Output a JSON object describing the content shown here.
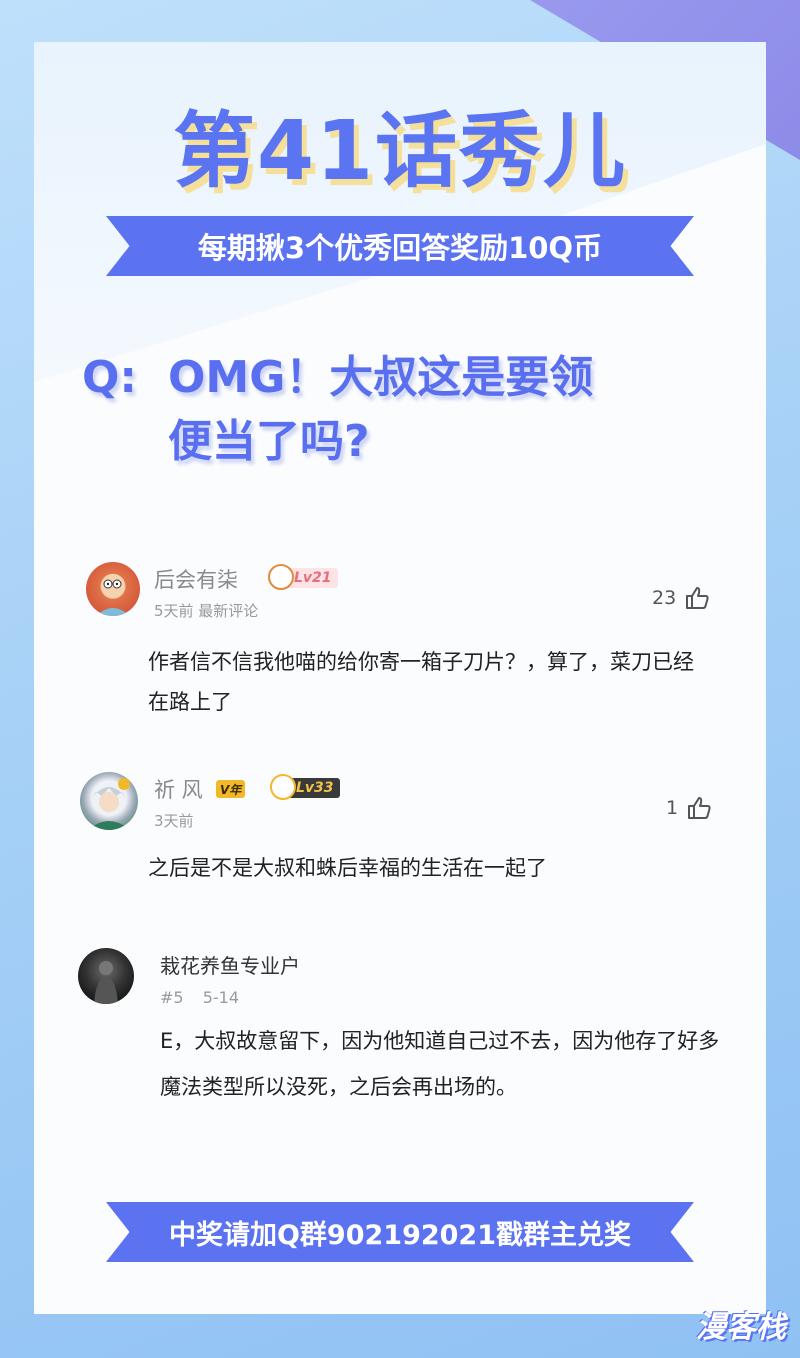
{
  "header": {
    "title": "第41话秀儿",
    "reward_banner": "每期揪3个优秀回答奖励10Q币"
  },
  "question": {
    "prefix": "Q:",
    "line1": "OMG！大叔这是要领",
    "line2": "便当了吗?"
  },
  "comments": [
    {
      "username": "后会有柒",
      "level": "Lv21",
      "meta": "5天前 最新评论",
      "likes": "23",
      "text": "作者信不信我他喵的给你寄一箱子刀片？，算了，菜刀已经在路上了"
    },
    {
      "username": "祈 风",
      "vip": "V年",
      "level": "Lv33",
      "meta": "3天前",
      "likes": "1",
      "text": "之后是不是大叔和蛛后幸福的生活在一起了"
    },
    {
      "username": "栽花养鱼专业户",
      "meta_index": "#5",
      "meta_date": "5-14",
      "text": "E，大叔故意留下，因为他知道自己过不去，因为他存了好多魔法类型所以没死，之后会再出场的。"
    }
  ],
  "footer": {
    "banner": "中奖请加Q群902192021戳群主兑奖"
  },
  "watermark": "漫客栈",
  "colors": {
    "accent": "#5b73f0",
    "title_shadow": "#f4e09a",
    "card": "#fbfcfe"
  }
}
